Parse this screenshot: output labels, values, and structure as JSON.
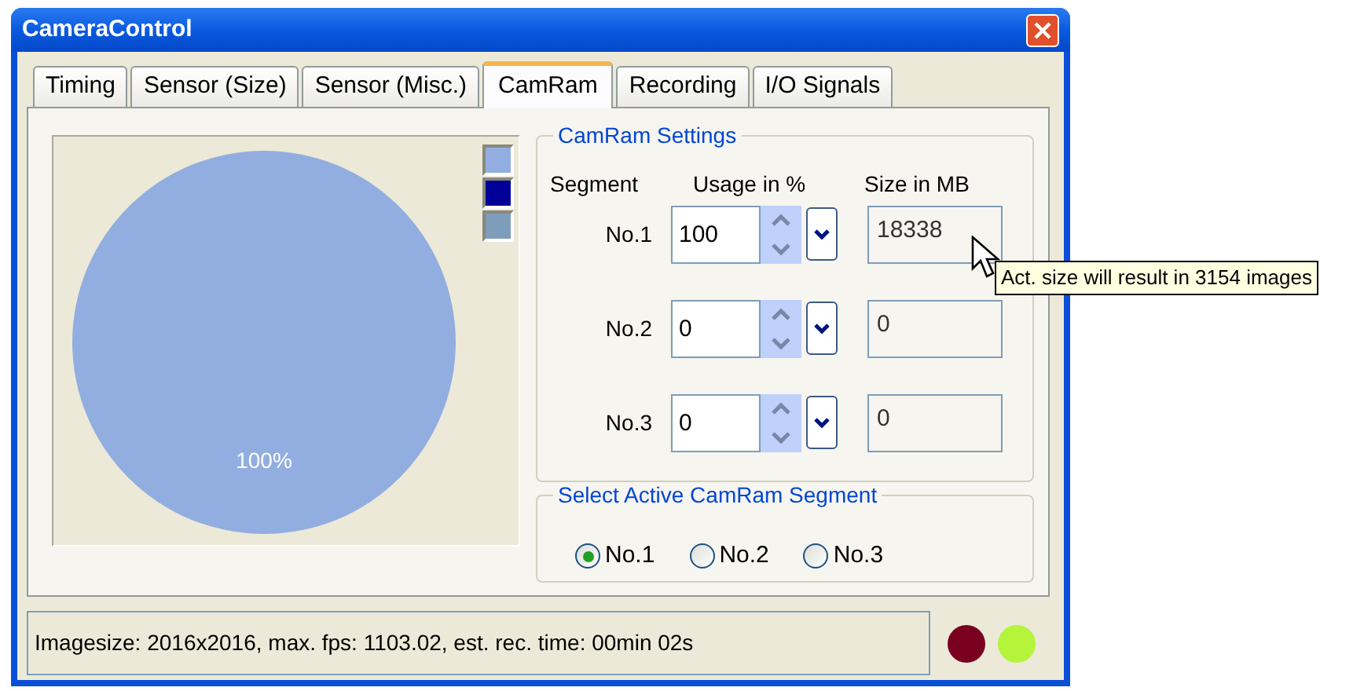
{
  "window": {
    "title": "CameraControl"
  },
  "tabs": [
    {
      "label": "Timing",
      "selected": false
    },
    {
      "label": "Sensor (Size)",
      "selected": false
    },
    {
      "label": "Sensor (Misc.)",
      "selected": false
    },
    {
      "label": "CamRam",
      "selected": true
    },
    {
      "label": "Recording",
      "selected": false
    },
    {
      "label": "I/O Signals",
      "selected": false
    }
  ],
  "usage_chart": {
    "chart_data": {
      "type": "pie",
      "values": [
        100,
        0,
        0
      ],
      "value_labels": [
        "100%",
        null,
        null
      ]
    },
    "legend": [
      {
        "color": "#92aee0"
      },
      {
        "color": "#000099"
      },
      {
        "color": "#7e9dba"
      }
    ]
  },
  "camram_settings": {
    "title": "CamRam Settings",
    "columns": [
      "Segment",
      "Usage in %",
      "Size in MB"
    ],
    "rows": [
      {
        "segment": "No.1",
        "usage": "100",
        "size": "18338"
      },
      {
        "segment": "No.2",
        "usage": "0",
        "size": "0"
      },
      {
        "segment": "No.3",
        "usage": "0",
        "size": "0"
      }
    ]
  },
  "active_segment": {
    "title": "Select Active CamRam Segment",
    "options": [
      {
        "label": "No.1",
        "selected": true
      },
      {
        "label": "No.2",
        "selected": false
      },
      {
        "label": "No.3",
        "selected": false
      }
    ]
  },
  "status_bar": {
    "text": "Imagesize: 2016x2016, max. fps: 1103.02, est. rec. time: 00min 02s",
    "indicators": [
      {
        "color": "#7a0020"
      },
      {
        "color": "#b4f53c"
      }
    ]
  },
  "tooltip": "Act. size will result in 3154 images"
}
